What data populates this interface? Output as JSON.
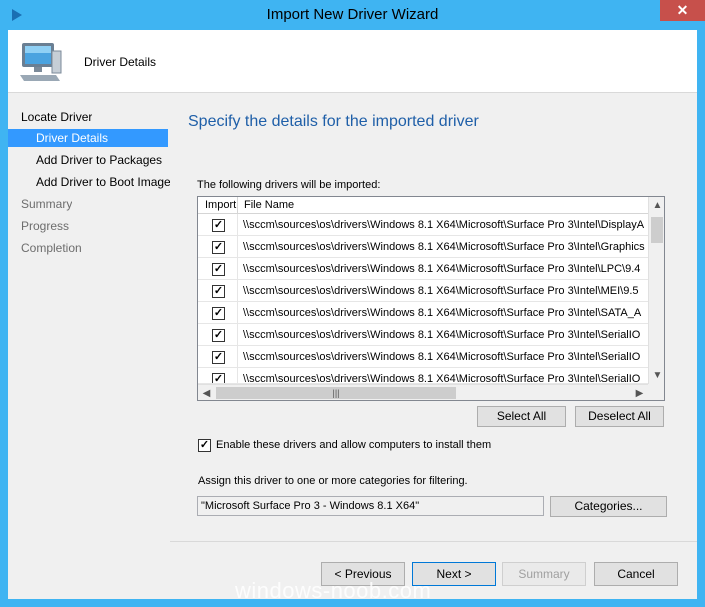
{
  "window": {
    "title": "Import New Driver Wizard",
    "close_glyph": "✕"
  },
  "header": {
    "icon": "computer-monitor-icon",
    "title": "Driver Details"
  },
  "sidebar": {
    "items": [
      {
        "label": "Locate Driver",
        "state": "done"
      },
      {
        "label": "Driver Details",
        "state": "current"
      },
      {
        "label": "Add Driver to Packages",
        "state": "done"
      },
      {
        "label": "Add Driver to Boot Image",
        "state": "done"
      },
      {
        "label": "Summary",
        "state": "pending"
      },
      {
        "label": "Progress",
        "state": "pending"
      },
      {
        "label": "Completion",
        "state": "pending"
      }
    ]
  },
  "main": {
    "heading": "Specify the details for the imported driver",
    "list_caption": "The following drivers will be imported:",
    "columns": [
      "Import",
      "File Name"
    ],
    "rows": [
      {
        "checked": true,
        "path": "\\\\sccm\\sources\\os\\drivers\\Windows 8.1 X64\\Microsoft\\Surface Pro 3\\Intel\\DisplayA"
      },
      {
        "checked": true,
        "path": "\\\\sccm\\sources\\os\\drivers\\Windows 8.1 X64\\Microsoft\\Surface Pro 3\\Intel\\Graphics"
      },
      {
        "checked": true,
        "path": "\\\\sccm\\sources\\os\\drivers\\Windows 8.1 X64\\Microsoft\\Surface Pro 3\\Intel\\LPC\\9.4"
      },
      {
        "checked": true,
        "path": "\\\\sccm\\sources\\os\\drivers\\Windows 8.1 X64\\Microsoft\\Surface Pro 3\\Intel\\MEI\\9.5"
      },
      {
        "checked": true,
        "path": "\\\\sccm\\sources\\os\\drivers\\Windows 8.1 X64\\Microsoft\\Surface Pro 3\\Intel\\SATA_A"
      },
      {
        "checked": true,
        "path": "\\\\sccm\\sources\\os\\drivers\\Windows 8.1 X64\\Microsoft\\Surface Pro 3\\Intel\\SerialIO"
      },
      {
        "checked": true,
        "path": "\\\\sccm\\sources\\os\\drivers\\Windows 8.1 X64\\Microsoft\\Surface Pro 3\\Intel\\SerialIO"
      },
      {
        "checked": true,
        "path": "\\\\sccm\\sources\\os\\drivers\\Windows 8.1 X64\\Microsoft\\Surface Pro 3\\Intel\\SerialIO"
      }
    ],
    "check_glyph": "✓",
    "select_all": "Select All",
    "deselect_all": "Deselect All",
    "enable_checked": true,
    "enable_label": "Enable these drivers and allow computers to install them",
    "assign_caption": "Assign this driver to one or more categories for filtering.",
    "category_value": "\"Microsoft Surface Pro 3 - Windows 8.1 X64\"",
    "categories_button": "Categories..."
  },
  "footer": {
    "previous": "< Previous",
    "next": "Next >",
    "summary": "Summary",
    "cancel": "Cancel"
  },
  "watermark": "windows-noob.com",
  "colors": {
    "title_bar": "#3fb4f2",
    "close_button": "#c7504b",
    "selection": "#3399ff",
    "heading": "#1f5fa8"
  }
}
